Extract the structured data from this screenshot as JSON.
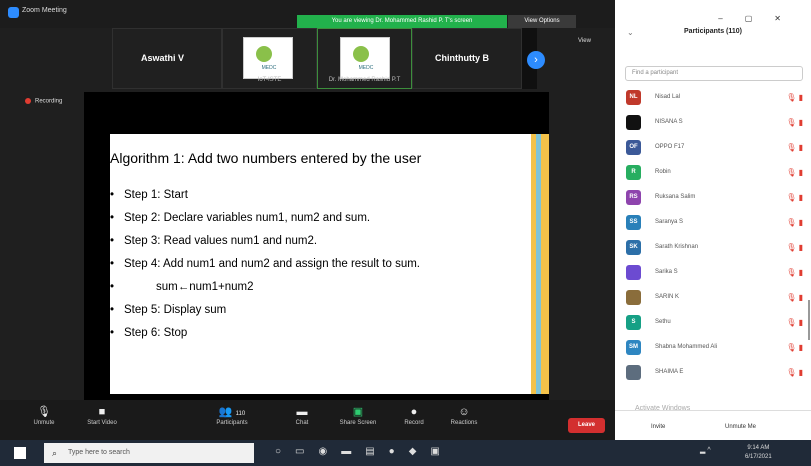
{
  "window": {
    "app_title": "Zoom Meeting",
    "viewing_banner": "You are viewing Dr. Mohammed Rashid P. T's screen",
    "view_options": "View Options"
  },
  "thumbs": {
    "left_name": "Aswathi V",
    "logo1_label": "IoT-ISTE",
    "logo1_text": "MEDC",
    "logo2_label": "Dr. Mohammed Rashid P.T",
    "logo2_text": "MEDC",
    "right_name": "Chinthutty B",
    "next_arrow": "›",
    "view_label": "View"
  },
  "recording": "Recording",
  "slide": {
    "title": "Algorithm 1: Add two numbers entered by the user",
    "steps": [
      "Step 1: Start",
      "Step 2: Declare variables num1, num2 and sum.",
      "Step 3: Read values num1 and num2.",
      "Step 4: Add num1 and num2 and assign the result to sum.",
      "sum←num1+num2",
      "Step 5: Display sum",
      "Step 6: Stop"
    ]
  },
  "panel": {
    "title": "Participants (110)",
    "search_placeholder": "Find a participant",
    "participants": [
      {
        "initials": "NL",
        "name": "Nisad Lal",
        "color": "#c0392b"
      },
      {
        "initials": "",
        "name": "NISANA S",
        "color": "#111111"
      },
      {
        "initials": "OF",
        "name": "OPPO F17",
        "color": "#3b5998"
      },
      {
        "initials": "R",
        "name": "Robin",
        "color": "#27ae60"
      },
      {
        "initials": "RS",
        "name": "Ruksana Salim",
        "color": "#8e44ad"
      },
      {
        "initials": "SS",
        "name": "Saranya S",
        "color": "#2980b9"
      },
      {
        "initials": "SK",
        "name": "Sarath Krishnan",
        "color": "#2c6fa8"
      },
      {
        "initials": "",
        "name": "Sarika S",
        "color": "#6c4bd1"
      },
      {
        "initials": "",
        "name": "SARIN K",
        "color": "#8a6d3b"
      },
      {
        "initials": "S",
        "name": "Sethu",
        "color": "#16a085"
      },
      {
        "initials": "SM",
        "name": "Shabna Mohammed Ali",
        "color": "#2e86c1"
      },
      {
        "initials": "",
        "name": "SHAIMA E",
        "color": "#5d6d7e"
      }
    ],
    "invite": "Invite",
    "unmute_me": "Unmute Me",
    "watermark": "Activate Windows"
  },
  "toolbar": {
    "unmute": "Unmute",
    "start_video": "Start Video",
    "participants_count": "110",
    "participants": "Participants",
    "chat": "Chat",
    "share_screen": "Share Screen",
    "record": "Record",
    "reactions": "Reactions",
    "leave": "Leave"
  },
  "taskbar": {
    "search_placeholder": "Type here to search",
    "time": "9:14 AM",
    "date": "6/17/2021"
  }
}
